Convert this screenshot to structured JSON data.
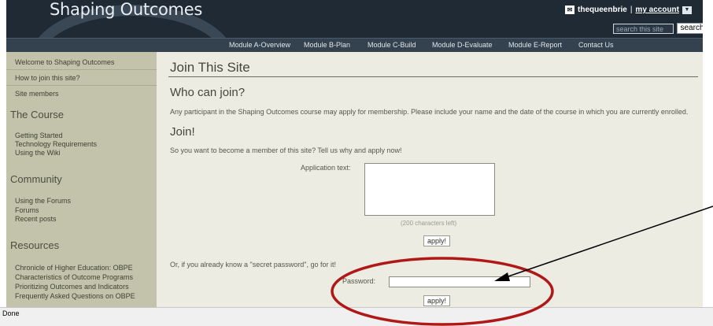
{
  "header": {
    "site_title": "Shaping Outcomes",
    "username": "thequeenbrie",
    "separator": "|",
    "my_account": "my account",
    "search_placeholder": "search this site",
    "search_button": "search"
  },
  "nav": {
    "items": [
      "Module A-Overview",
      "Module B-Plan",
      "Module C-Build",
      "Module D-Evaluate",
      "Module E-Report",
      "Contact Us"
    ]
  },
  "sidebar": {
    "top_links": [
      "Welcome to Shaping Outcomes",
      "How to join this site?",
      "Site members"
    ],
    "sections": [
      {
        "heading": "The Course",
        "links": [
          "Getting Started",
          "Technology Requirements",
          "Using the Wiki"
        ]
      },
      {
        "heading": "Community",
        "links": [
          "Using the Forums",
          "Forums",
          "Recent posts"
        ]
      },
      {
        "heading": "Resources",
        "links": [
          "Chronicle of Higher Education: OBPE",
          "Characteristics of Outcome Programs",
          "Prioritizing Outcomes and Indicators",
          "Frequently Asked Questions on OBPE"
        ]
      }
    ]
  },
  "main": {
    "page_title": "Join This Site",
    "who_heading": "Who can join?",
    "who_text": "Any participant in the Shaping Outcomes course may apply for membership. Please include your name and the date of the course in which you are currently enrolled.",
    "join_heading": "Join!",
    "join_text": "So you want to become a member of this site? Tell us why and apply now!",
    "application_label": "Application text:",
    "chars_left": "(200 characters left)",
    "apply_label": "apply!",
    "secret_text": "Or, if you already know a \"secret password\", go for it!",
    "password_label": "Password:",
    "apply_label_2": "apply!"
  },
  "status_bar": {
    "text": "Done"
  },
  "colors": {
    "header_bg": "#1f2a35",
    "nav_bg": "#34414e",
    "sidebar_bg": "#c2c3aa",
    "content_bg": "#ecece3",
    "annotation_red": "#b01818"
  }
}
